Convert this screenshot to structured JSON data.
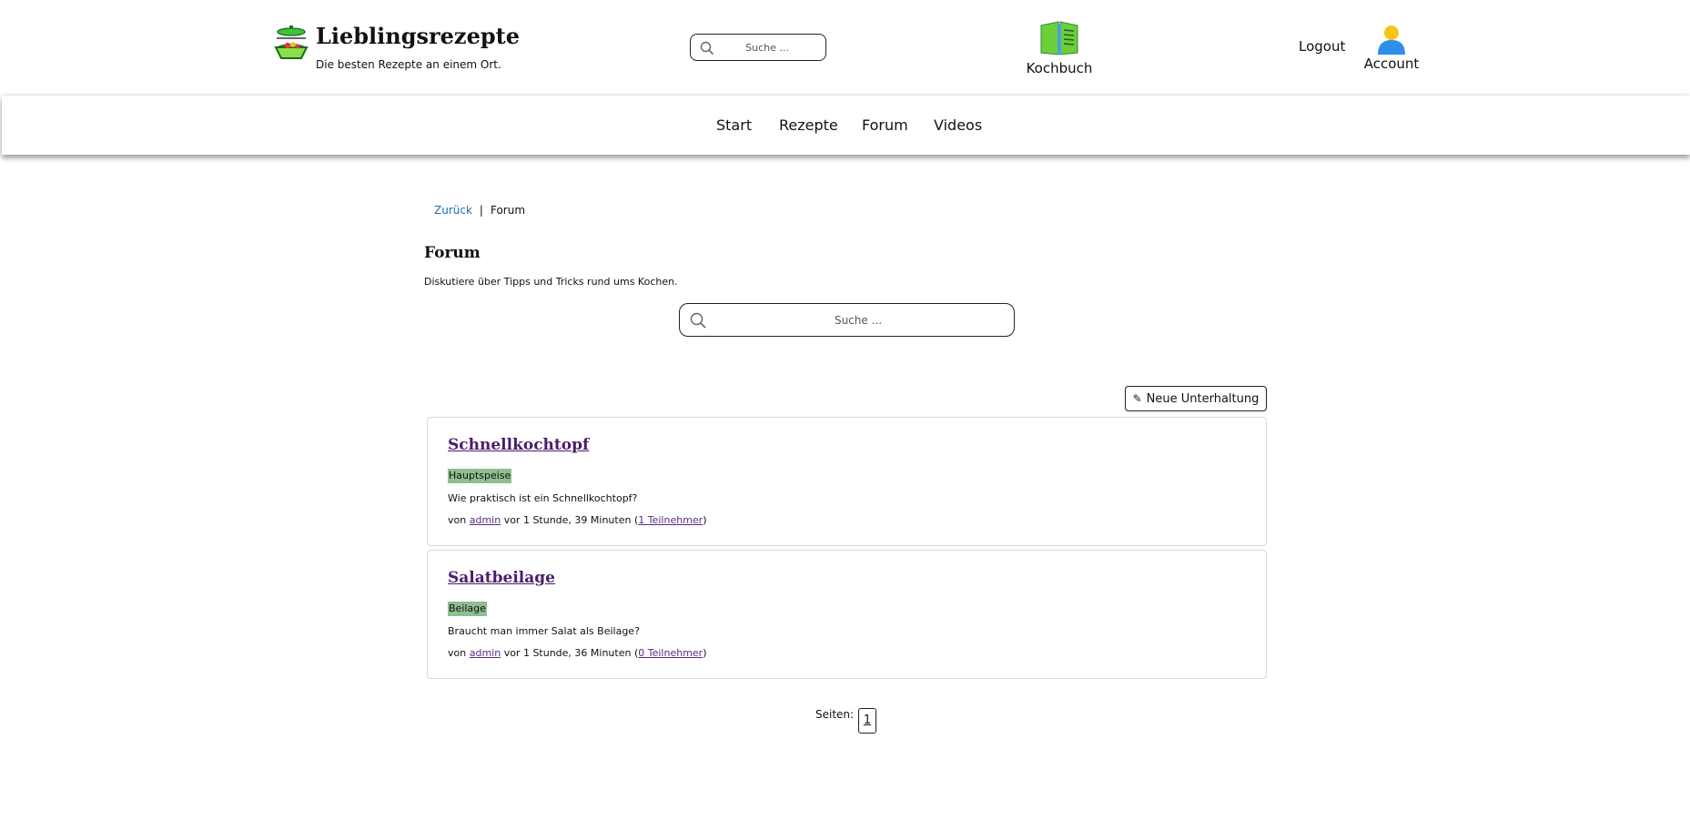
{
  "header": {
    "brand_title": "Lieblingsrezepte",
    "brand_subtitle": "Die besten Rezepte an einem Ort.",
    "search_placeholder": "Suche ...",
    "kochbuch_label": "Kochbuch",
    "logout_label": "Logout",
    "account_label": "Account"
  },
  "nav": {
    "items": [
      {
        "label": "Start"
      },
      {
        "label": "Rezepte"
      },
      {
        "label": "Forum"
      },
      {
        "label": "Videos"
      }
    ]
  },
  "breadcrumb": {
    "back_label": "Zurück",
    "separator": "|",
    "current": "Forum"
  },
  "forum": {
    "title": "Forum",
    "description": "Diskutiere über Tipps und Tricks rund ums Kochen.",
    "search_placeholder": "Suche ...",
    "new_conversation_label": "Neue Unterhaltung",
    "threads": [
      {
        "title": "Schnellkochtopf",
        "tag": "Hauptspeise",
        "description": "Wie praktisch ist ein Schnellkochtopf?",
        "by_prefix": "von",
        "author": "admin",
        "time": "vor 1 Stunde, 39 Minuten",
        "participants": "1 Teilnehmer"
      },
      {
        "title": "Salatbeilage",
        "tag": "Beilage",
        "description": "Braucht man immer Salat als Beilage?",
        "by_prefix": "von",
        "author": "admin",
        "time": "vor 1 Stunde, 36 Minuten",
        "participants": "0 Teilnehmer"
      }
    ]
  },
  "pagination": {
    "label": "Seiten:",
    "pages": [
      "1"
    ]
  },
  "colors": {
    "link": "#1f6fb3",
    "visited_link": "#4b1c6b",
    "tag_bg": "#8dbf8f",
    "book_green": "#6ccf3a",
    "account_head": "#f5c518",
    "account_body": "#2f8fe8"
  },
  "icons": [
    "pot-logo-icon",
    "search-icon",
    "book-icon",
    "user-icon",
    "pencil-icon"
  ]
}
